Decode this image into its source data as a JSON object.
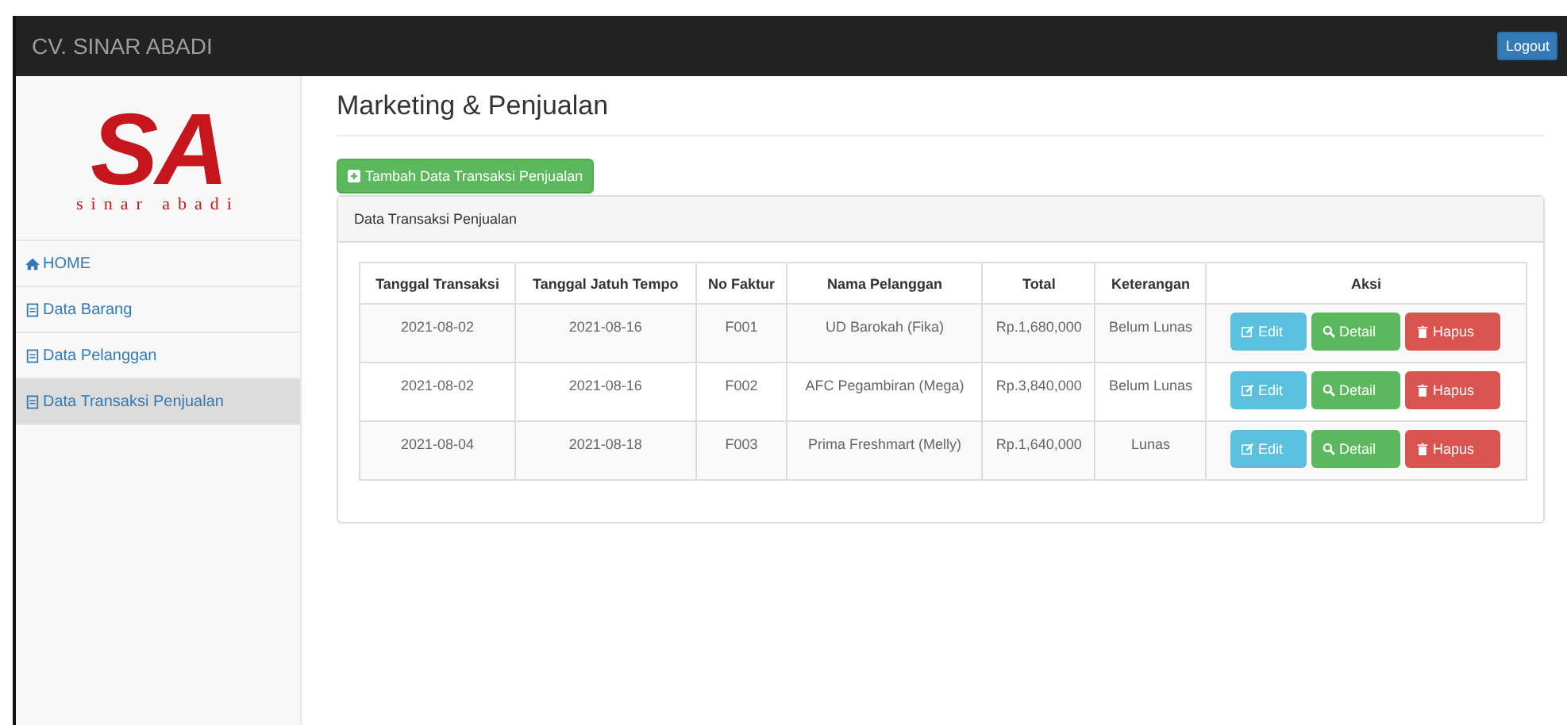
{
  "navbar": {
    "brand": "CV. SINAR ABADI",
    "logout": "Logout"
  },
  "logo": {
    "letters": "SA",
    "tagline": "sinar abadi"
  },
  "sidebar": {
    "items": [
      {
        "label": "HOME",
        "kind": "home",
        "selected": false
      },
      {
        "label": "Data Barang",
        "kind": "page",
        "selected": false
      },
      {
        "label": "Data Pelanggan",
        "kind": "page",
        "selected": false
      },
      {
        "label": "Data Transaksi Penjualan",
        "kind": "page",
        "selected": true
      }
    ]
  },
  "page_title": "Marketing & Penjualan",
  "add_button": "Tambah Data Transaksi Penjualan",
  "panel": {
    "heading": "Data Transaksi Penjualan",
    "table": {
      "columns": [
        "Tanggal Transaksi",
        "Tanggal Jatuh Tempo",
        "No Faktur",
        "Nama Pelanggan",
        "Total",
        "Keterangan",
        "Aksi"
      ],
      "rows": [
        {
          "cells": [
            "2021-08-02",
            "2021-08-16",
            "F001",
            "UD Barokah (Fika)",
            "Rp.1,680,000",
            "Belum Lunas"
          ],
          "actions": [
            {
              "kind": "edit",
              "label": "Edit"
            },
            {
              "kind": "detail",
              "label": "Detail"
            },
            {
              "kind": "delete",
              "label": "Hapus"
            }
          ]
        },
        {
          "cells": [
            "2021-08-02",
            "2021-08-16",
            "F002",
            "AFC Pegambiran (Mega)",
            "Rp.3,840,000",
            "Belum Lunas"
          ],
          "actions": [
            {
              "kind": "edit",
              "label": "Edit"
            },
            {
              "kind": "detail",
              "label": "Detail"
            },
            {
              "kind": "delete",
              "label": "Hapus"
            }
          ]
        },
        {
          "cells": [
            "2021-08-04",
            "2021-08-18",
            "F003",
            "Prima Freshmart (Melly)",
            "Rp.1,640,000",
            "Lunas"
          ],
          "actions": [
            {
              "kind": "edit",
              "label": "Edit"
            },
            {
              "kind": "detail",
              "label": "Detail"
            },
            {
              "kind": "delete",
              "label": "Hapus"
            }
          ]
        }
      ]
    }
  }
}
